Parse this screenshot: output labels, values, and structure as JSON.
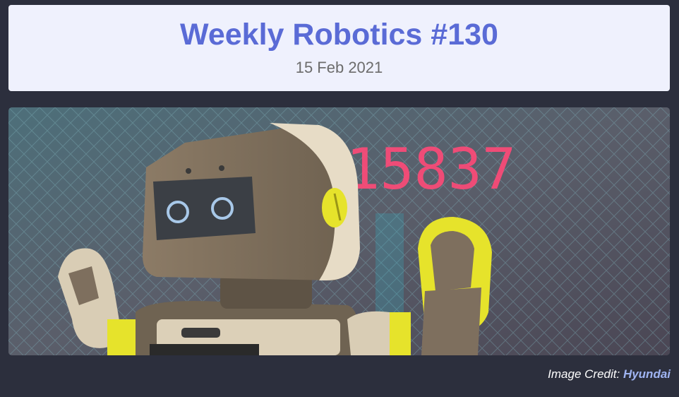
{
  "header": {
    "title": "Weekly Robotics #130",
    "date": "15 Feb 2021"
  },
  "hero": {
    "subject": "robot",
    "display_digits": "215837",
    "colors": {
      "robot_body": "#7e6f5e",
      "robot_face": "#cfc3ad",
      "accent": "#e6e32b",
      "digits": "#ff3d6e"
    }
  },
  "credit": {
    "prefix": "Image Credit: ",
    "link_text": "Hyundai"
  }
}
